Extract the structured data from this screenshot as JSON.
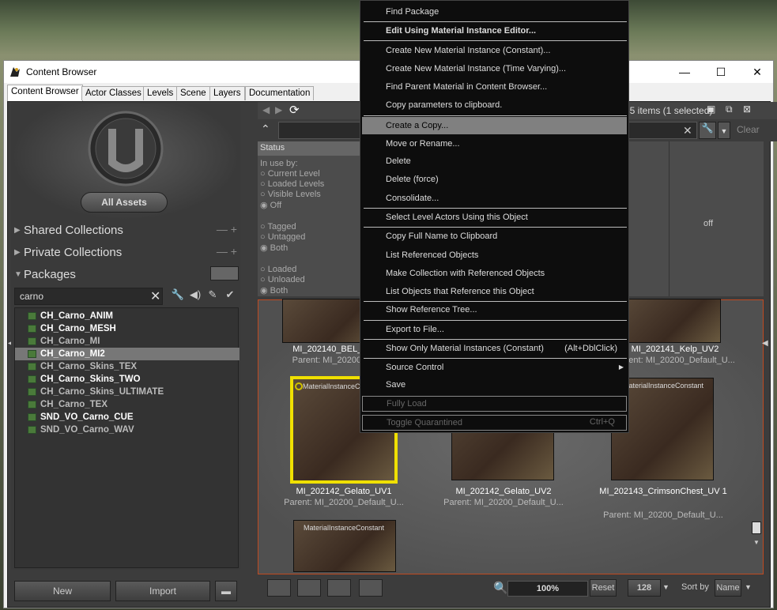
{
  "window": {
    "title": "Content Browser"
  },
  "tabs": [
    "Content Browser",
    "Actor Classes",
    "Levels",
    "Scene",
    "Layers",
    "Documentation"
  ],
  "left": {
    "all_assets": "All Assets",
    "shared_collections": "Shared Collections",
    "private_collections": "Private Collections",
    "packages": "Packages",
    "search_value": "carno",
    "packages_list": [
      {
        "name": "CH_Carno_ANIM",
        "state": "bold"
      },
      {
        "name": "CH_Carno_MESH",
        "state": "bold"
      },
      {
        "name": "CH_Carno_MI",
        "state": "dim"
      },
      {
        "name": "CH_Carno_MI2",
        "state": "selected"
      },
      {
        "name": "CH_Carno_Skins_TEX",
        "state": "dim"
      },
      {
        "name": "CH_Carno_Skins_TWO",
        "state": "bold"
      },
      {
        "name": "CH_Carno_Skins_ULTIMATE",
        "state": "dim"
      },
      {
        "name": "CH_Carno_TEX",
        "state": "dim"
      },
      {
        "name": "SND_VO_Carno_CUE",
        "state": "bold"
      },
      {
        "name": "SND_VO_Carno_WAV",
        "state": "dim"
      }
    ],
    "new_label": "New",
    "import_label": "Import"
  },
  "right": {
    "items_count": "85 items (1 selected)",
    "clear_label": "Clear",
    "status_header": "Status",
    "in_use_by": "In use by:",
    "current_level": "Current Level",
    "loaded_levels": "Loaded Levels",
    "visible_levels": "Visible Levels",
    "off": "Off",
    "tagged": "Tagged",
    "untagged": "Untagged",
    "both": "Both",
    "loaded": "Loaded",
    "unloaded": "Unloaded",
    "both2": "Both",
    "off_right": "off",
    "thumb_type": "MaterialInstanceConstant",
    "assets": [
      {
        "name": "MI_202140_BEL_UV2",
        "parent": "Parent: MI_20200_Def"
      },
      {
        "name": "MI_202141_Kelp_UV2",
        "parent": "Parent: MI_20200_Default_U..."
      },
      {
        "name": "MI_202142_Gelato_UV1",
        "parent": "Parent: MI_20200_Default_U..."
      },
      {
        "name": "MI_202142_Gelato_UV2",
        "parent": "Parent: MI_20200_Default_U..."
      },
      {
        "name": "MI_202143_CrimsonChest_UV 1",
        "parent": "Parent: MI_20200_Default_U..."
      }
    ],
    "zoom": "100%",
    "reset_label": "Reset",
    "thumb_size": "128",
    "sort_by_label": "Sort by",
    "sort_value": "Name"
  },
  "context_menu": {
    "items": [
      {
        "label": "Find Package",
        "style": "normal"
      },
      {
        "label": "Edit Using Material Instance Editor...",
        "style": "bold"
      },
      {
        "label": "Create New Material Instance (Constant)...",
        "style": "normal"
      },
      {
        "label": "Create New Material Instance (Time Varying)...",
        "style": "normal"
      },
      {
        "label": "Find Parent Material in Content Browser...",
        "style": "normal"
      },
      {
        "label": "Copy parameters to clipboard.",
        "style": "normal"
      },
      {
        "label": "Create a Copy...",
        "style": "highlight"
      },
      {
        "label": "Move or Rename...",
        "style": "normal"
      },
      {
        "label": "Delete",
        "style": "normal"
      },
      {
        "label": "Delete (force)",
        "style": "normal"
      },
      {
        "label": "Consolidate...",
        "style": "normal"
      },
      {
        "label": "Select Level Actors Using this Object",
        "style": "normal"
      },
      {
        "label": "Copy Full Name to Clipboard",
        "style": "normal"
      },
      {
        "label": "List Referenced Objects",
        "style": "normal"
      },
      {
        "label": "Make Collection with Referenced Objects",
        "style": "normal"
      },
      {
        "label": "List Objects that Reference this Object",
        "style": "normal"
      },
      {
        "label": "Show Reference Tree...",
        "style": "normal"
      },
      {
        "label": "Export to File...",
        "style": "normal"
      },
      {
        "label": "Show Only Material Instances (Constant)",
        "shortcut": "(Alt+DblClick)",
        "style": "normal"
      },
      {
        "label": "Source Control",
        "style": "submenu"
      },
      {
        "label": "Save",
        "style": "normal"
      },
      {
        "label": "Fully Load",
        "style": "disabled"
      },
      {
        "label": "Toggle Quarantined",
        "shortcut": "Ctrl+Q",
        "style": "disabled"
      }
    ]
  }
}
